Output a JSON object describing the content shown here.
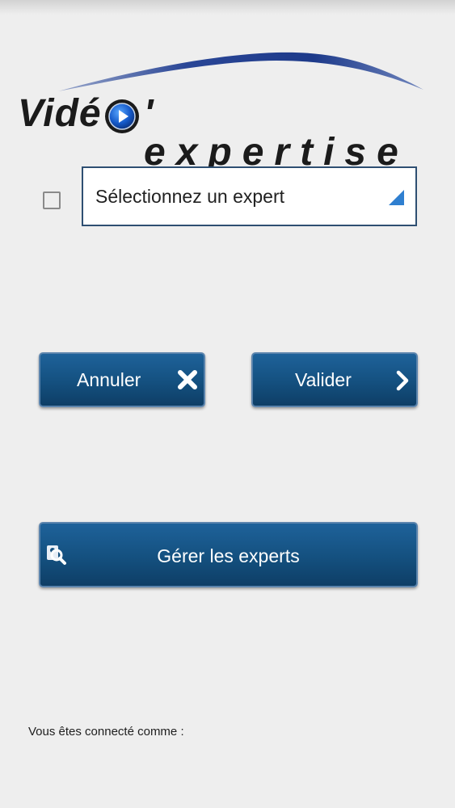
{
  "logo": {
    "text_left": "Vidé",
    "text_right": "' expertise"
  },
  "expert_select": {
    "selected_value": "Sélectionnez un expert",
    "checkbox_checked": false
  },
  "buttons": {
    "cancel_label": "Annuler",
    "validate_label": "Valider",
    "manage_label": "Gérer les experts"
  },
  "status": {
    "connected_as": "Vous êtes connecté comme :"
  },
  "colors": {
    "button_blue": "#14507f",
    "select_arrow": "#2f7fd0",
    "logo_arc": "#1f3f88"
  },
  "icons": {
    "cancel": "close-icon",
    "validate": "chevron-right-icon",
    "manage": "user-search-icon",
    "logo_play": "play-icon"
  }
}
